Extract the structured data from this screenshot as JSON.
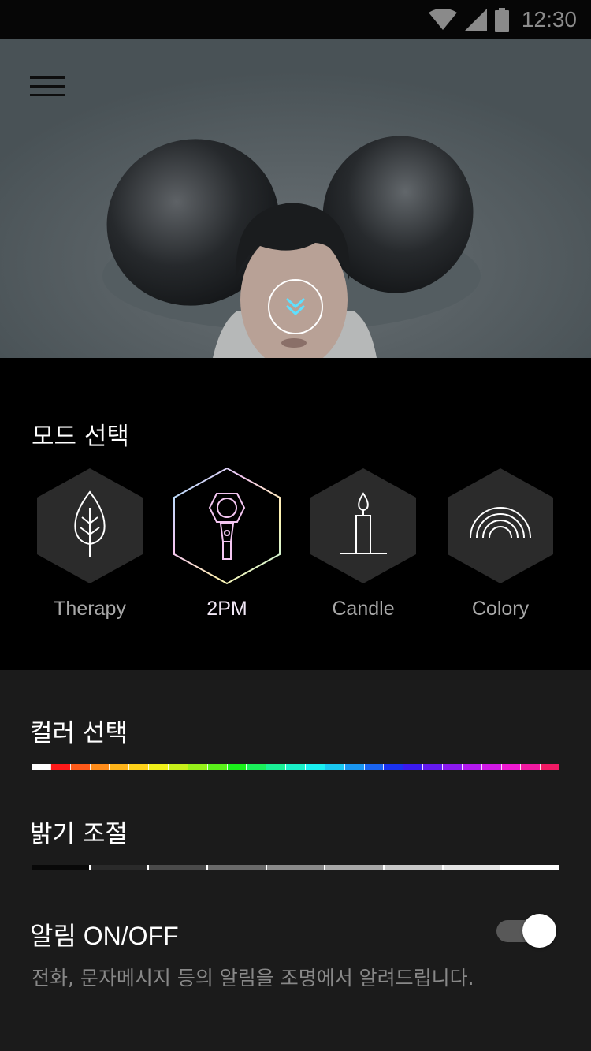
{
  "status_bar": {
    "time": "12:30",
    "icons": [
      "wifi-icon",
      "cellular-signal-icon",
      "battery-icon"
    ]
  },
  "hero": {
    "menu_icon": "hamburger-menu-icon",
    "expand_icon": "double-chevron-down-icon"
  },
  "mode": {
    "title": "모드 선택",
    "items": [
      {
        "label": "Therapy",
        "icon": "leaf-icon",
        "selected": false
      },
      {
        "label": "2PM",
        "icon": "lightstick-icon",
        "selected": true
      },
      {
        "label": "Candle",
        "icon": "candle-icon",
        "selected": false
      },
      {
        "label": "Colory",
        "icon": "rainbow-icon",
        "selected": false
      }
    ]
  },
  "controls": {
    "color_title": "컬러 선택",
    "brightness_title": "밝기 조절",
    "notification_title": "알림 ON/OFF",
    "notification_desc": "전화, 문자메시지 등의 알림을 조명에서 알려드립니다.",
    "notification_on": true
  },
  "colors": {
    "accent_cyan": "#5ee0ff",
    "hex_fill": "#2b2b2b",
    "color_scale": [
      "#ffffff",
      "#ff1a1a",
      "#ff5a1a",
      "#ff8c1a",
      "#ffb41a",
      "#ffd21a",
      "#f0f01a",
      "#c8f01a",
      "#96f01a",
      "#5af01a",
      "#1af01a",
      "#1af05a",
      "#1af096",
      "#1af0c8",
      "#1af0f0",
      "#1ac8f0",
      "#1a96f0",
      "#1a64f0",
      "#1a32f0",
      "#3a1af0",
      "#641af0",
      "#8c1af0",
      "#b41af0",
      "#d21ae6",
      "#f01ad2",
      "#f01aa0",
      "#f01a64"
    ],
    "brightness_scale": [
      "#080808",
      "#2a2a2a",
      "#4a4a4a",
      "#6a6a6a",
      "#8a8a8a",
      "#a8a8a8",
      "#c8c8c8",
      "#e4e4e4",
      "#ffffff"
    ]
  }
}
